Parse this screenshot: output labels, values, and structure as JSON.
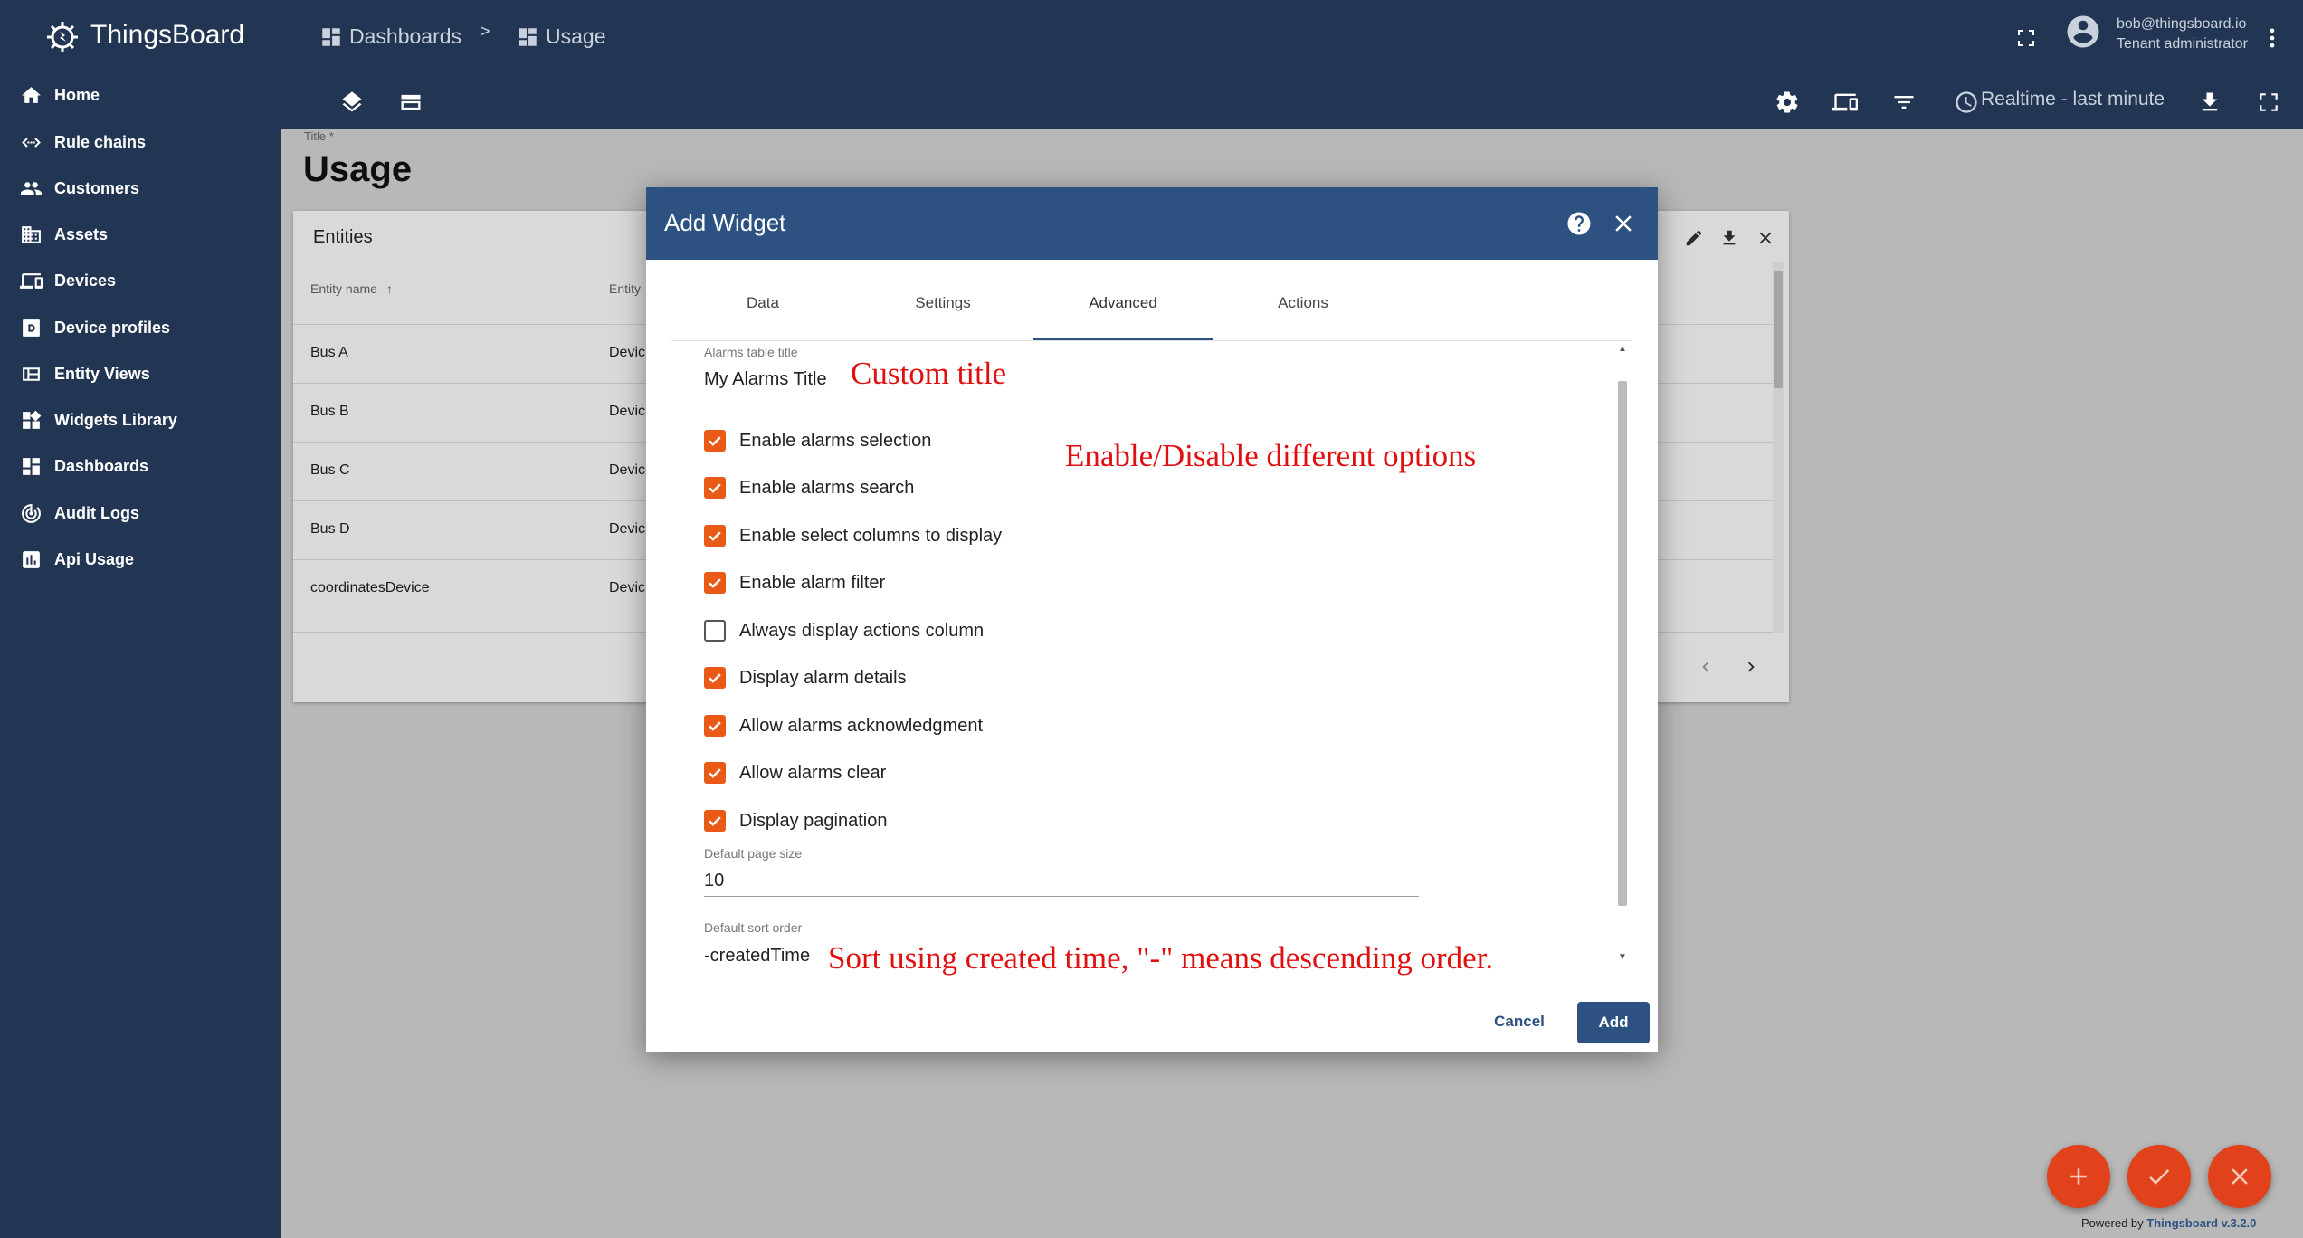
{
  "app": {
    "name": "ThingsBoard",
    "logo_icon": "thingsboard-logo-icon"
  },
  "sidebar": {
    "items": [
      {
        "label": "Home",
        "icon": "home-icon"
      },
      {
        "label": "Rule chains",
        "icon": "code-arrows-icon"
      },
      {
        "label": "Customers",
        "icon": "people-icon"
      },
      {
        "label": "Assets",
        "icon": "building-icon"
      },
      {
        "label": "Devices",
        "icon": "devices-icon"
      },
      {
        "label": "Device profiles",
        "icon": "device-profile-icon"
      },
      {
        "label": "Entity Views",
        "icon": "view-quilt-icon"
      },
      {
        "label": "Widgets Library",
        "icon": "widgets-icon"
      },
      {
        "label": "Dashboards",
        "icon": "dashboard-icon"
      },
      {
        "label": "Audit Logs",
        "icon": "track-changes-icon"
      },
      {
        "label": "Api Usage",
        "icon": "insert-chart-icon"
      }
    ]
  },
  "header": {
    "breadcrumb": [
      {
        "label": "Dashboards",
        "icon": "dashboard-icon"
      },
      {
        "label": "Usage",
        "icon": "dashboard-icon"
      }
    ],
    "breadcrumb_separator": ">",
    "user": {
      "email": "bob@thingsboard.io",
      "role": "Tenant administrator"
    },
    "timewindow_label": "Realtime - last minute"
  },
  "dashboard": {
    "title_label": "Title *",
    "title": "Usage",
    "entities_widget": {
      "title": "Entities",
      "columns": [
        "Entity name",
        "Entity"
      ],
      "rows": [
        {
          "name": "Bus A",
          "type": "Devic"
        },
        {
          "name": "Bus B",
          "type": "Devic"
        },
        {
          "name": "Bus C",
          "type": "Devic"
        },
        {
          "name": "Bus D",
          "type": "Devic"
        },
        {
          "name": "coordinatesDevice",
          "type": "Devic"
        }
      ]
    }
  },
  "modal": {
    "title": "Add Widget",
    "tabs": [
      "Data",
      "Settings",
      "Advanced",
      "Actions"
    ],
    "active_tab": "Advanced",
    "table_title": {
      "label": "Alarms table title",
      "value": "My Alarms Title"
    },
    "options": [
      {
        "label": "Enable alarms selection",
        "checked": true
      },
      {
        "label": "Enable alarms search",
        "checked": true
      },
      {
        "label": "Enable select columns to display",
        "checked": true
      },
      {
        "label": "Enable alarm filter",
        "checked": true
      },
      {
        "label": "Always display actions column",
        "checked": false
      },
      {
        "label": "Display alarm details",
        "checked": true
      },
      {
        "label": "Allow alarms acknowledgment",
        "checked": true
      },
      {
        "label": "Allow alarms clear",
        "checked": true
      },
      {
        "label": "Display pagination",
        "checked": true
      }
    ],
    "page_size": {
      "label": "Default page size",
      "value": "10"
    },
    "sort_order": {
      "label": "Default sort order",
      "value": "-createdTime"
    },
    "cancel_label": "Cancel",
    "add_label": "Add"
  },
  "annotations": {
    "title": "Custom title",
    "options": "Enable/Disable different options",
    "sort": "Sort using created time, \"-\" means descending order."
  },
  "footer": {
    "powered_prefix": "Powered by ",
    "powered_link": "Thingsboard v.3.2.0"
  },
  "colors": {
    "sidebar": "#223552",
    "modal_header": "#2d5282",
    "checkbox": "#ea5a17",
    "fab": "#e1411b",
    "annotation": "#e01010"
  }
}
